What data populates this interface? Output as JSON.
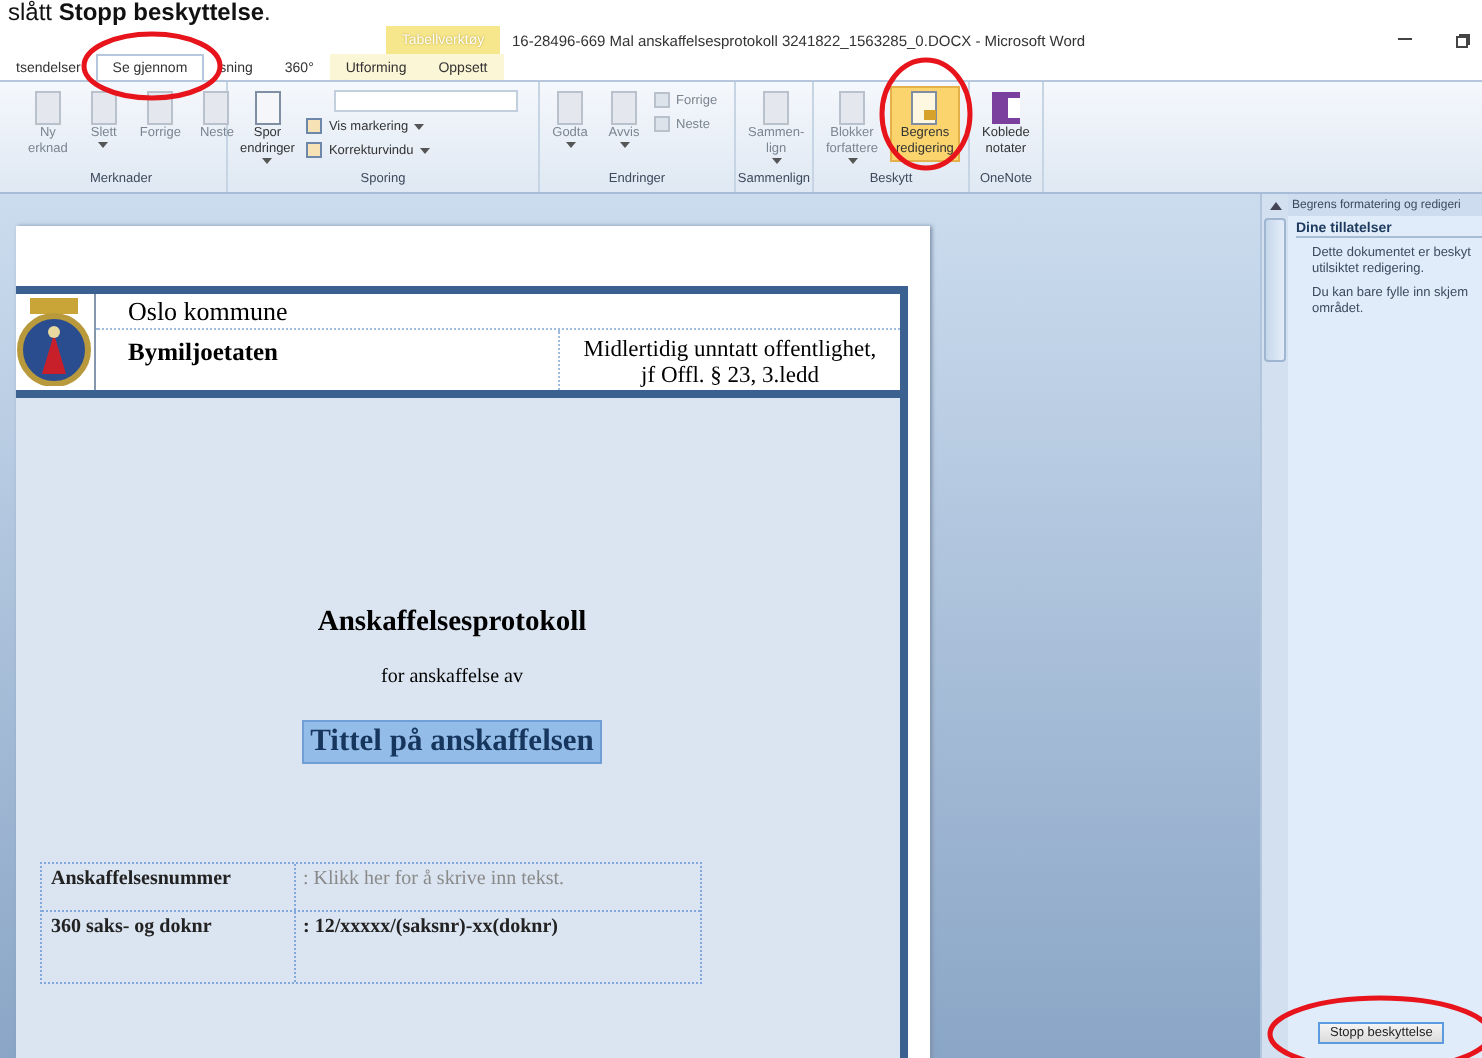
{
  "caption": "slått **Stopp beskyttelse**.",
  "window": {
    "title": "16-28496-669 Mal anskaffelsesprotokoll 3241822_1563285_0.DOCX - Microsoft Word",
    "context_group": "Tabellverktøy"
  },
  "tabs": [
    {
      "label": "tsendelser",
      "selected": false,
      "kind": "normal"
    },
    {
      "label": "Se gjennom",
      "selected": true,
      "kind": "normal"
    },
    {
      "label": "sning",
      "selected": false,
      "kind": "normal"
    },
    {
      "label": "360°",
      "selected": false,
      "kind": "normal"
    },
    {
      "label": "Utforming",
      "selected": false,
      "kind": "context"
    },
    {
      "label": "Oppsett",
      "selected": false,
      "kind": "context"
    }
  ],
  "ribbon": [
    {
      "label": "Merknader",
      "items": [
        {
          "kind": "large",
          "lines": [
            "Ny",
            "erknad"
          ],
          "disabled": true,
          "dropdown": false,
          "selected": false
        },
        {
          "kind": "large",
          "lines": [
            "Slett"
          ],
          "disabled": true,
          "dropdown": true,
          "selected": false
        },
        {
          "kind": "large",
          "lines": [
            "Forrige"
          ],
          "disabled": true,
          "dropdown": false,
          "selected": false
        },
        {
          "kind": "large",
          "lines": [
            "Neste"
          ],
          "disabled": true,
          "dropdown": false,
          "selected": false
        }
      ]
    },
    {
      "label": "Sporing",
      "items": [
        {
          "kind": "large",
          "lines": [
            "Spor",
            "endringer"
          ],
          "disabled": false,
          "dropdown": true,
          "selected": false
        },
        {
          "kind": "stack",
          "entries": [
            {
              "kind": "combo"
            },
            {
              "kind": "small",
              "label": "Vis markering",
              "disabled": false,
              "dropdown": true
            },
            {
              "kind": "small",
              "label": "Korrekturvindu",
              "disabled": false,
              "dropdown": true
            }
          ]
        }
      ]
    },
    {
      "label": "Endringer",
      "items": [
        {
          "kind": "large",
          "lines": [
            "Godta"
          ],
          "disabled": true,
          "dropdown": true,
          "selected": false
        },
        {
          "kind": "large",
          "lines": [
            "Avvis"
          ],
          "disabled": true,
          "dropdown": true,
          "selected": false
        },
        {
          "kind": "stack",
          "entries": [
            {
              "kind": "small",
              "label": "Forrige",
              "disabled": true,
              "dropdown": false
            },
            {
              "kind": "small",
              "label": "Neste",
              "disabled": true,
              "dropdown": false
            }
          ]
        }
      ]
    },
    {
      "label": "Sammenlign",
      "items": [
        {
          "kind": "large",
          "lines": [
            "Sammen-",
            "lign"
          ],
          "disabled": true,
          "dropdown": true,
          "selected": false
        }
      ]
    },
    {
      "label": "Beskytt",
      "items": [
        {
          "kind": "large",
          "lines": [
            "Blokker",
            "forfattere"
          ],
          "disabled": true,
          "dropdown": true,
          "selected": false
        },
        {
          "kind": "large",
          "lines": [
            "Begrens",
            "redigering"
          ],
          "disabled": false,
          "dropdown": false,
          "selected": true
        }
      ]
    },
    {
      "label": "OneNote",
      "items": [
        {
          "kind": "onenote",
          "lines": [
            "Koblede",
            "notater"
          ],
          "disabled": false,
          "dropdown": false,
          "selected": false
        }
      ]
    }
  ],
  "document": {
    "org": "Oslo kommune",
    "unit": "Bymiljoetaten",
    "classification": [
      "Midlertidig  unntatt offentlighet,",
      "jf Offl. § 23, 3.ledd"
    ],
    "heading": "Anskaffelsesprotokoll",
    "subheading": "for anskaffelse av",
    "title_field": {
      "value": "Tittel på anskaffelsen",
      "selected": true
    },
    "rows": [
      {
        "label": "Anskaffelsesnummer",
        "placeholder": ": Klikk her for å skrive inn tekst."
      },
      {
        "label": "360 saks- og doknr",
        "value": ": 12/xxxxx/(saksnr)-xx(doknr)"
      }
    ]
  },
  "pane": {
    "title": "Begrens formatering og redigeri",
    "section": "Dine tillatelser",
    "paragraphs": [
      [
        "Dette dokumentet er beskyt",
        "utilsiktet redigering."
      ],
      [
        "Du kan bare fylle inn skjem",
        "området."
      ]
    ],
    "button": "Stopp beskyttelse"
  }
}
